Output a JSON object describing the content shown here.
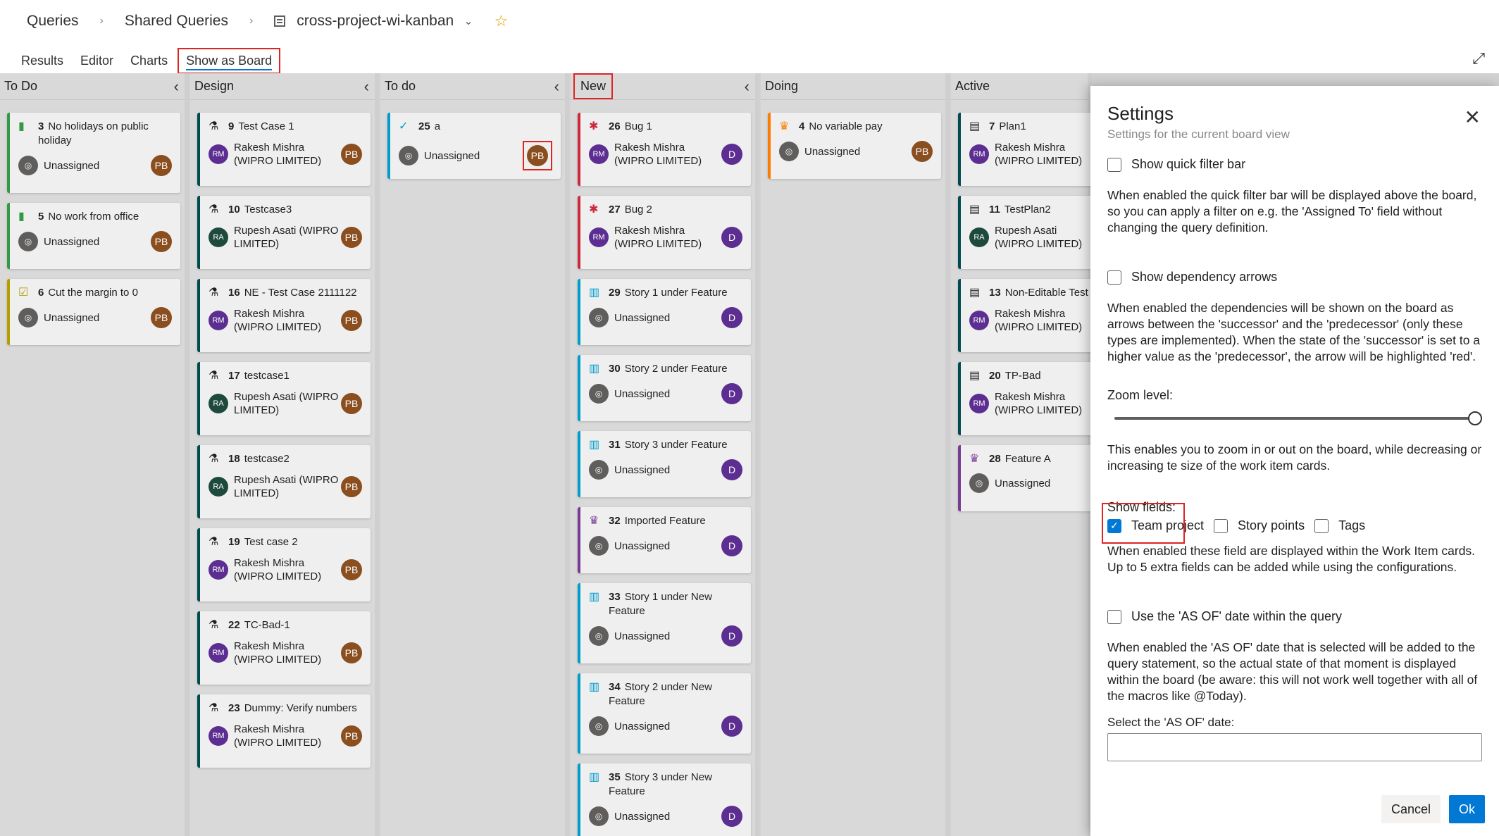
{
  "breadcrumb": {
    "item1": "Queries",
    "item2": "Shared Queries",
    "query": "cross-project-wi-kanban"
  },
  "tabs": [
    {
      "label": "Results"
    },
    {
      "label": "Editor"
    },
    {
      "label": "Charts"
    },
    {
      "label": "Show as Board"
    }
  ],
  "columns": [
    {
      "title": "To Do",
      "cards": [
        {
          "id": "3",
          "title": "No holidays on public holiday",
          "assignee": "Unassigned",
          "badge": "PB"
        },
        {
          "id": "5",
          "title": "No work from office",
          "assignee": "Unassigned",
          "badge": "PB"
        },
        {
          "id": "6",
          "title": "Cut the margin to 0",
          "assignee": "Unassigned",
          "badge": "PB"
        }
      ]
    },
    {
      "title": "Design",
      "cards": [
        {
          "id": "9",
          "title": "Test Case 1",
          "assignee": "Rakesh Mishra (WIPRO LIMITED)",
          "initials": "RM",
          "badge": "PB"
        },
        {
          "id": "10",
          "title": "Testcase3",
          "assignee": "Rupesh Asati (WIPRO LIMITED)",
          "initials": "RA",
          "badge": "PB"
        },
        {
          "id": "16",
          "title": "NE - Test Case 2111122",
          "assignee": "Rakesh Mishra (WIPRO LIMITED)",
          "initials": "RM",
          "badge": "PB"
        },
        {
          "id": "17",
          "title": "testcase1",
          "assignee": "Rupesh Asati (WIPRO LIMITED)",
          "initials": "RA",
          "badge": "PB"
        },
        {
          "id": "18",
          "title": "testcase2",
          "assignee": "Rupesh Asati (WIPRO LIMITED)",
          "initials": "RA",
          "badge": "PB"
        },
        {
          "id": "19",
          "title": "Test case 2",
          "assignee": "Rakesh Mishra (WIPRO LIMITED)",
          "initials": "RM",
          "badge": "PB"
        },
        {
          "id": "22",
          "title": "TC-Bad-1",
          "assignee": "Rakesh Mishra (WIPRO LIMITED)",
          "initials": "RM",
          "badge": "PB"
        },
        {
          "id": "23",
          "title": "Dummy: Verify numbers",
          "assignee": "Rakesh Mishra (WIPRO LIMITED)",
          "initials": "RM",
          "badge": "PB"
        }
      ]
    },
    {
      "title": "To do",
      "cards": [
        {
          "id": "25",
          "title": "a",
          "assignee": "Unassigned",
          "badge": "PB"
        }
      ]
    },
    {
      "title": "New",
      "cards": [
        {
          "id": "26",
          "title": "Bug 1",
          "assignee": "Rakesh Mishra (WIPRO LIMITED)",
          "initials": "RM",
          "badge": "D"
        },
        {
          "id": "27",
          "title": "Bug 2",
          "assignee": "Rakesh Mishra (WIPRO LIMITED)",
          "initials": "RM",
          "badge": "D"
        },
        {
          "id": "29",
          "title": "Story 1 under Feature",
          "assignee": "Unassigned",
          "badge": "D"
        },
        {
          "id": "30",
          "title": "Story 2 under Feature",
          "assignee": "Unassigned",
          "badge": "D"
        },
        {
          "id": "31",
          "title": "Story 3 under Feature",
          "assignee": "Unassigned",
          "badge": "D"
        },
        {
          "id": "32",
          "title": "Imported Feature",
          "assignee": "Unassigned",
          "badge": "D"
        },
        {
          "id": "33",
          "title": "Story 1 under New Feature",
          "assignee": "Unassigned",
          "badge": "D"
        },
        {
          "id": "34",
          "title": "Story 2 under New Feature",
          "assignee": "Unassigned",
          "badge": "D"
        },
        {
          "id": "35",
          "title": "Story 3 under New Feature",
          "assignee": "Unassigned",
          "badge": "D"
        }
      ]
    },
    {
      "title": "Doing",
      "cards": [
        {
          "id": "4",
          "title": "No variable pay",
          "assignee": "Unassigned",
          "badge": "PB"
        }
      ]
    },
    {
      "title": "Active",
      "cards": [
        {
          "id": "7",
          "title": "Plan1",
          "assignee": "Rakesh Mishra (WIPRO LIMITED)",
          "initials": "RM"
        },
        {
          "id": "11",
          "title": "TestPlan2",
          "assignee": "Rupesh Asati (WIPRO LIMITED)",
          "initials": "RA"
        },
        {
          "id": "13",
          "title": "Non-Editable Test",
          "assignee": "Rakesh Mishra (WIPRO LIMITED)",
          "initials": "RM"
        },
        {
          "id": "20",
          "title": "TP-Bad",
          "assignee": "Rakesh Mishra (WIPRO LIMITED)",
          "initials": "RM"
        },
        {
          "id": "28",
          "title": "Feature A",
          "assignee": "Unassigned"
        }
      ]
    }
  ],
  "settings": {
    "title": "Settings",
    "subtitle": "Settings for the current board view",
    "quick_filter_label": "Show quick filter bar",
    "quick_filter_desc": "When enabled the quick filter bar will be displayed above the board, so you can apply a filter on e.g. the 'Assigned To' field without changing the query definition.",
    "dependency_label": "Show dependency arrows",
    "dependency_desc": "When enabled the dependencies will be shown on the board as arrows between the 'successor' and the 'predecessor' (only these types are implemented). When the state of the 'successor' is set to a higher value as the 'predecessor', the arrow will be highlighted 'red'.",
    "zoom_label": "Zoom level:",
    "zoom_value": 1.0,
    "zoom_desc": "This enables you to zoom in or out on the board, while decreasing or increasing te size of the work item cards.",
    "fields_label": "Show fields:",
    "field_team_project": "Team project",
    "field_story_points": "Story points",
    "field_tags": "Tags",
    "fields_desc": "When enabled these field are displayed within the Work Item cards. Up to 5 extra fields can be added while using the configurations.",
    "asof_label": "Use the 'AS OF' date within the query",
    "asof_desc": "When enabled the 'AS OF' date that is selected will be added to the query statement, so the actual state of that moment is displayed within the board (be aware: this will not work well together with all of the macros like @Today).",
    "asof_date_label": "Select the 'AS OF' date:",
    "asof_date_value": "",
    "cancel": "Cancel",
    "ok": "Ok"
  }
}
